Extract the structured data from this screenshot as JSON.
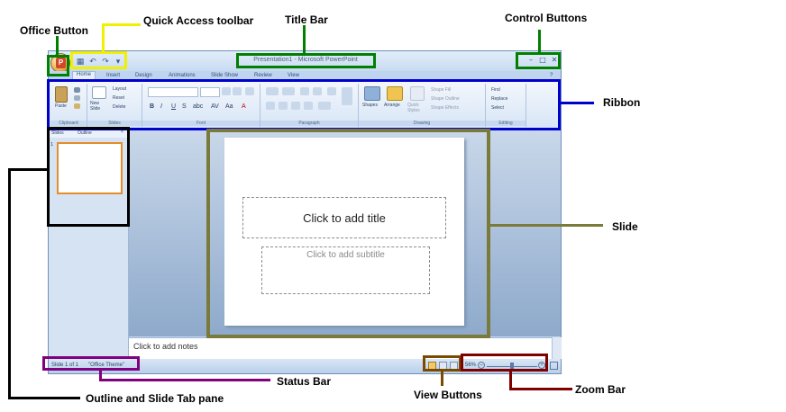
{
  "labels": {
    "office_button": "Office Button",
    "quick_access": "Quick Access toolbar",
    "title_bar": "Title Bar",
    "control_buttons": "Control Buttons",
    "ribbon": "Ribbon",
    "slide": "Slide",
    "outline_pane": "Outline and Slide Tab pane",
    "status_bar": "Status Bar",
    "view_buttons": "View Buttons",
    "zoom_bar": "Zoom Bar"
  },
  "window": {
    "title": "Presentation1 - Microsoft PowerPoint"
  },
  "tabs": [
    "Home",
    "Insert",
    "Design",
    "Animations",
    "Slide Show",
    "Review",
    "View"
  ],
  "ribbon": {
    "groups": [
      "Clipboard",
      "Slides",
      "Font",
      "Paragraph",
      "Drawing",
      "Editing"
    ],
    "paste": "Paste",
    "new_slide": "New Slide",
    "layout": "Layout",
    "reset": "Reset",
    "delete": "Delete",
    "shapes": "Shapes",
    "arrange": "Arrange",
    "quick_styles": "Quick Styles",
    "shape_fill": "Shape Fill",
    "shape_outline": "Shape Outline",
    "shape_effects": "Shape Effects",
    "find": "Find",
    "replace": "Replace",
    "select": "Select"
  },
  "pane": {
    "tab_slides": "Slides",
    "tab_outline": "Outline",
    "thumb_number": "1"
  },
  "slide": {
    "title_placeholder": "Click to add title",
    "subtitle_placeholder": "Click to add subtitle"
  },
  "notes": "Click to add notes",
  "status": {
    "slide_info": "Slide 1 of 1",
    "theme": "\"Office Theme\"",
    "zoom": "56%"
  },
  "colors": {
    "office_button_box": "#008000",
    "quick_access_box": "#f0f000",
    "title_bar_box": "#008000",
    "control_buttons_box": "#008000",
    "ribbon_box": "#0000cc",
    "slide_box": "#7a7a3a",
    "outline_box": "#000000",
    "status_box": "#800080",
    "view_box": "#7a4a00",
    "zoom_box": "#800000"
  }
}
